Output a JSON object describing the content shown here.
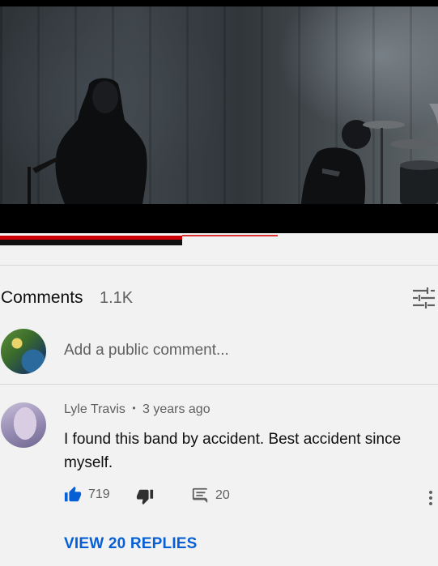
{
  "video": {
    "progress_played_fraction": 0.416,
    "progress_loaded_fraction": 0.634
  },
  "comments": {
    "title": "Comments",
    "count": "1.1K",
    "sort_icon": "sort-sliders-icon",
    "add_placeholder": "Add a public comment..."
  },
  "comment": {
    "author": "Lyle Travis",
    "separator": "•",
    "time": "3 years ago",
    "text": "I found this band by accident. Best accident since myself.",
    "likes": "719",
    "replies_count": "20",
    "view_replies_label": "VIEW 20 REPLIES",
    "icons": {
      "like": "thumbs-up-icon",
      "dislike": "thumbs-down-icon",
      "reply": "reply-comment-icon",
      "more": "more-vert-icon"
    },
    "colors": {
      "like_active": "#065fd4",
      "link": "#065fd4",
      "progress": "#cc0000"
    }
  }
}
